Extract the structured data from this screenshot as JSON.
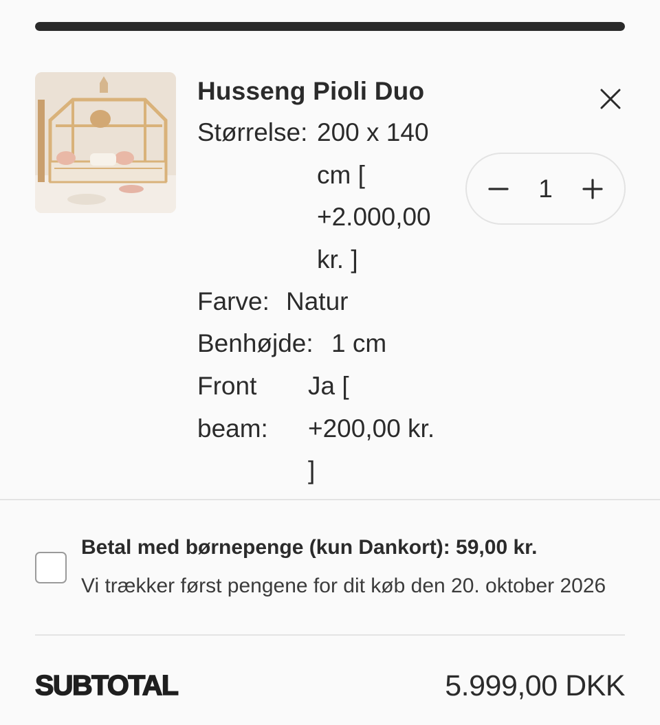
{
  "progress": {
    "fraction": 1.0
  },
  "cart_item": {
    "image_alt": "Husseng Pioli Duo",
    "title": "Husseng Pioli Duo",
    "options": [
      {
        "label": "Størrelse:",
        "value": "200 x 140 cm [ +2.000,00 kr. ]"
      },
      {
        "label": "Farve:",
        "value": "Natur"
      },
      {
        "label": "Benhøjde:",
        "value": "1 cm"
      },
      {
        "label": "Front beam:",
        "value": "Ja [ +200,00 kr. ]"
      }
    ],
    "quantity": "1",
    "remove_icon": "close-icon",
    "minus_icon": "minus-icon",
    "plus_icon": "plus-icon"
  },
  "bornepenge": {
    "checked": false,
    "label": "Betal med børnepenge (kun Dankort): 59,00 kr.",
    "note": "Vi trækker først pengene for dit køb den 20. oktober 2026"
  },
  "subtotal": {
    "label": "SUBTOTAL",
    "value": "5.999,00 DKK"
  },
  "colors": {
    "text": "#2b2b2b",
    "progress": "#2a2a2a",
    "border": "#e3e3e3",
    "background": "#fafafa"
  }
}
